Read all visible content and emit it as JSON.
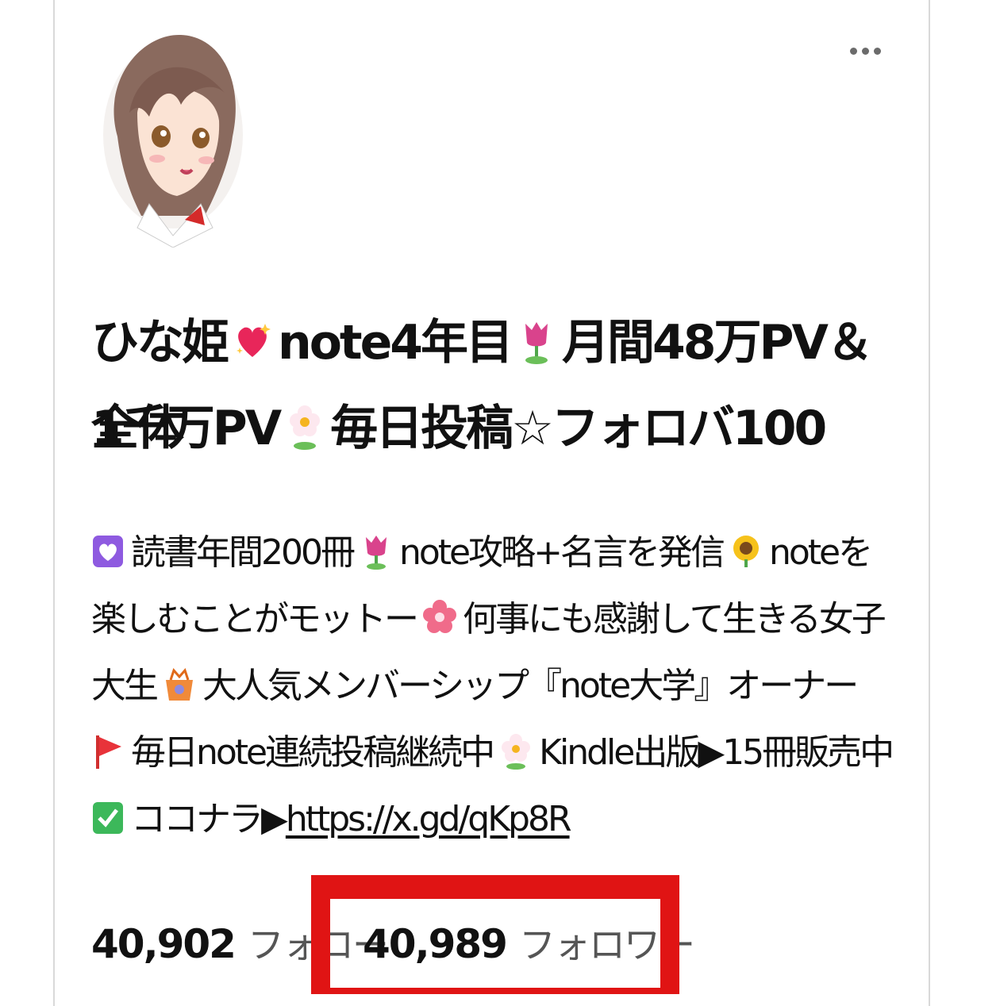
{
  "profile": {
    "name_line1": [
      "ひな姫",
      "note4年目",
      "月間48万PV＆全体"
    ],
    "name_line2": [
      "1千万PV",
      "毎日投稿☆フォロバ100"
    ],
    "bio": {
      "line1": [
        "読書年間200冊",
        "note攻略+名言を発信",
        "noteを"
      ],
      "line2": [
        "楽しむことがモットー",
        "何事にも感謝して生きる女子"
      ],
      "line3": [
        "大生",
        "大人気メンバーシップ『note大学』オーナー"
      ],
      "line4": [
        "毎日note連続投稿継続中",
        "Kindle出版▶15冊販売中"
      ],
      "line5_text": "ココナラ▶",
      "line5_link": "https://x.gd/qKp8R"
    }
  },
  "stats": {
    "following_count": "40,902",
    "following_label": "フォロー",
    "followers_count": "40,989",
    "followers_label": "フォロワー"
  },
  "icons": {
    "menu": "more-dots-icon",
    "heart": "sparkling-heart-icon",
    "tulip": "tulip-icon",
    "blossom": "white-flower-icon",
    "purple_heart": "purple-heart-icon",
    "sunflower": "sunflower-icon",
    "pink_flower": "cherry-blossom-icon",
    "gift": "gift-basket-icon",
    "flag": "red-flag-icon",
    "check": "green-check-icon"
  },
  "colors": {
    "highlight": "#e01414",
    "text": "#111111",
    "muted": "#555555"
  }
}
